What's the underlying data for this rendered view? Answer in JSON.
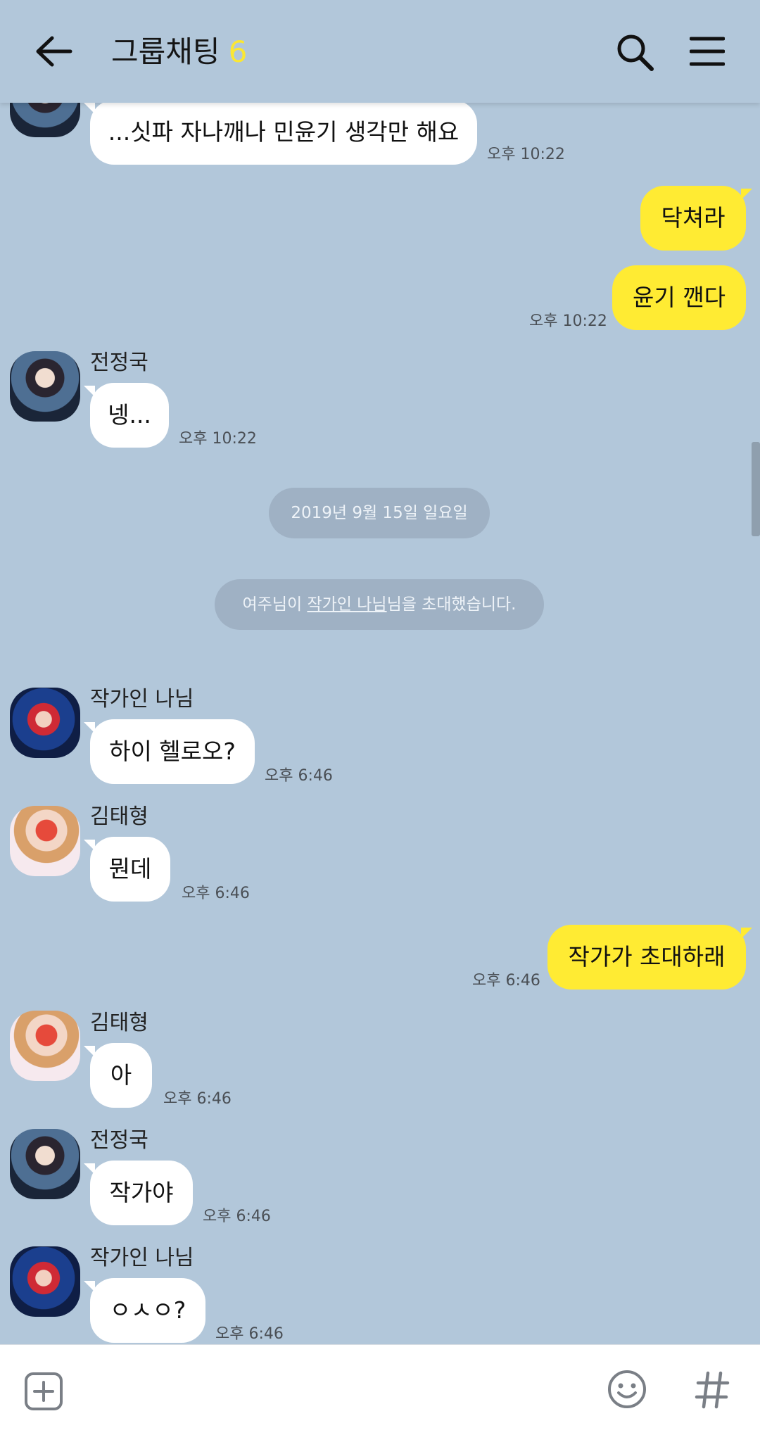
{
  "header": {
    "title": "그룹채팅",
    "member_count": "6"
  },
  "messages": [
    {
      "text": "...싯파 자나깨나 민윤기 생각만 해요",
      "time": "오후 10:22"
    },
    {
      "text": "닥쳐라"
    },
    {
      "text": "윤기 깬다",
      "time": "오후 10:22"
    },
    {
      "sender": "전정국",
      "text": "넹...",
      "time": "오후 10:22"
    },
    {
      "sender": "작가인 나님",
      "text": "하이 헬로오?",
      "time": "오후 6:46"
    },
    {
      "sender": "김태형",
      "text": "뭔데",
      "time": "오후 6:46"
    },
    {
      "text": "작가가 초대하래",
      "time": "오후 6:46"
    },
    {
      "sender": "김태형",
      "text": "아",
      "time": "오후 6:46"
    },
    {
      "sender": "전정국",
      "text": "작가야",
      "time": "오후 6:46"
    },
    {
      "sender": "작가인 나님",
      "text": "ㅇㅅㅇ?",
      "time": "오후 6:46"
    }
  ],
  "system": {
    "date_divider": "2019년 9월 15일 일요일",
    "invite_prefix": "여주님이 ",
    "invite_name": "작가인 나님",
    "invite_suffix": "님을 초대했습니다."
  },
  "icons": {
    "back": "arrow-left-icon",
    "search": "search-icon",
    "menu": "hamburger-menu-icon",
    "plus": "plus-square-icon",
    "emoji": "smiley-icon",
    "hash": "hashtag-icon"
  },
  "colors": {
    "chat_background": "#b2c7da",
    "my_bubble": "#ffeb33",
    "other_bubble": "#ffffff",
    "member_count": "#fbe733",
    "system_pill": "#9fb1c4"
  }
}
